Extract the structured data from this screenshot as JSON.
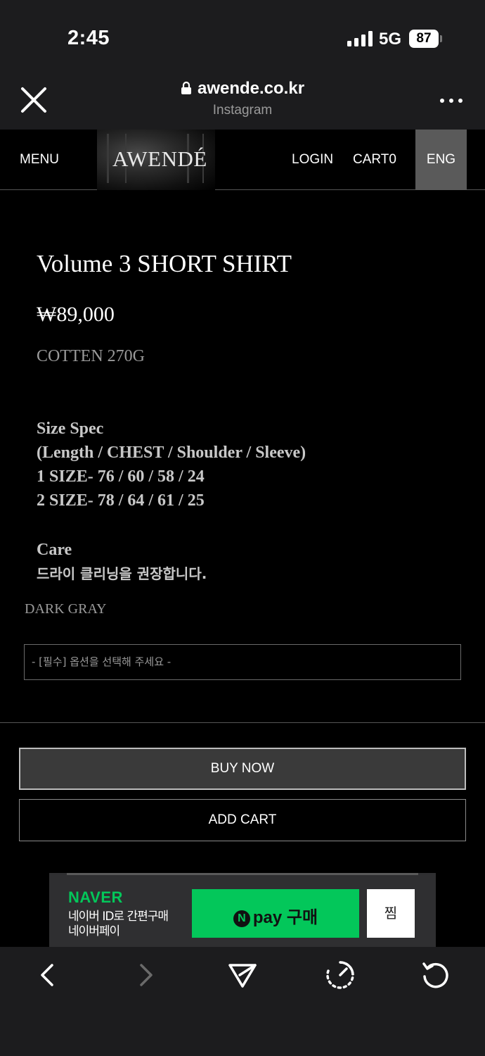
{
  "status_bar": {
    "time": "2:45",
    "network": "5G",
    "battery": "87"
  },
  "browser": {
    "url": "awende.co.kr",
    "source": "Instagram",
    "close_icon": "close-icon",
    "more_icon": "more-horizontal-icon"
  },
  "site_nav": {
    "menu": "MENU",
    "logo": "AWENDÉ",
    "login": "LOGIN",
    "cart": "CART0",
    "language": "ENG"
  },
  "product": {
    "title": "Volume 3 SHORT SHIRT",
    "price": "₩89,000",
    "material": "COTTEN 270G",
    "size_spec": {
      "heading": "Size Spec",
      "columns": "(Length / CHEST / Shoulder / Sleeve)",
      "rows": [
        "1 SIZE- 76 / 60 / 58 / 24",
        "2 SIZE- 78 / 64 / 61 / 25"
      ]
    },
    "care": {
      "heading": "Care",
      "text": "드라이 클리닝을 권장합니다."
    },
    "color_label": "DARK GRAY",
    "option_placeholder": "- [필수] 옵션을 선택해 주세요 -",
    "buy_now": "BUY NOW",
    "add_cart": "ADD CART"
  },
  "npay": {
    "brand": "NAVER",
    "desc_line1": "네이버 ID로 간편구매",
    "desc_line2": "네이버페이",
    "button_pay": "pay",
    "button_buy": "구매",
    "zzim": "찜"
  },
  "colors": {
    "npay_green": "#03c75a",
    "nav_eng_bg": "#5a5a5a",
    "buy_bg": "#3a3a3a"
  }
}
